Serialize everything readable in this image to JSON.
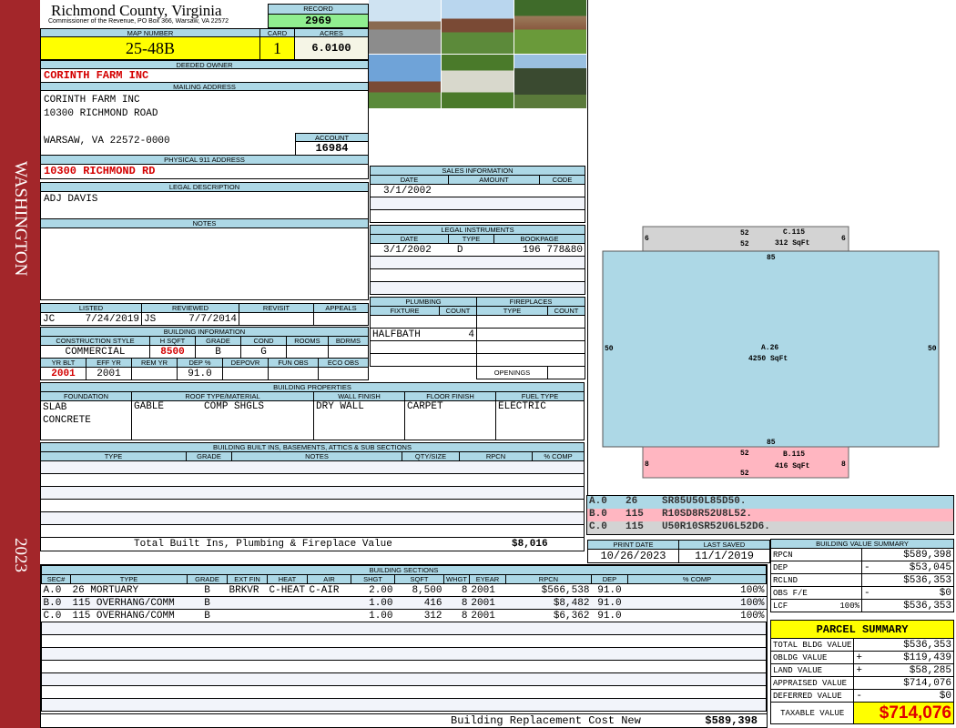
{
  "sidebar": {
    "top_text": "WASHINGTON",
    "bottom_text": "2023",
    "color": "#a3262a"
  },
  "header": {
    "title": "Richmond County, Virginia",
    "subtitle": "Commissioner of the Revenue, PO Box 366, Warsaw, VA 22572",
    "record_label": "RECORD",
    "record": "2969"
  },
  "parcel": {
    "map_label": "MAP NUMBER",
    "map_number": "25-48B",
    "card_label": "CARD",
    "card": "1",
    "acres_label": "ACRES",
    "acres": "6.0100",
    "deeded_owner_label": "DEEDED OWNER",
    "deeded_owner": "CORINTH FARM INC",
    "mailing_label": "MAILING ADDRESS",
    "mailing": [
      "CORINTH FARM INC",
      "10300 RICHMOND ROAD",
      "",
      "WARSAW, VA 22572-0000"
    ],
    "account_label": "ACCOUNT",
    "account": "16984",
    "physical_label": "PHYSICAL 911 ADDRESS",
    "physical": "10300 RICHMOND RD",
    "legal_label": "LEGAL DESCRIPTION",
    "legal": "ADJ DAVIS",
    "notes_label": "NOTES"
  },
  "review": {
    "headers": [
      "LISTED",
      "REVIEWED",
      "REVISIT",
      "APPEALS"
    ],
    "listed_by": "JC",
    "listed_date": "7/24/2019",
    "reviewed_by": "JS",
    "reviewed_date": "7/7/2014"
  },
  "building_info": {
    "title": "BUILDING INFORMATION",
    "headers1": [
      "CONSTRUCTION STYLE",
      "H SQFT",
      "GRADE",
      "COND",
      "ROOMS",
      "BDRMS"
    ],
    "values1": [
      "COMMERCIAL",
      "8500",
      "B",
      "G",
      "",
      ""
    ],
    "headers2": [
      "YR BLT",
      "EFF YR",
      "REM YR",
      "DEP %",
      "DEPOVR",
      "FUN OBS",
      "ECO OBS"
    ],
    "values2": [
      "2001",
      "2001",
      "",
      "91.0",
      "",
      "",
      ""
    ]
  },
  "building_properties": {
    "title": "BUILDING PROPERTIES",
    "headers": [
      "FOUNDATION",
      "ROOF TYPE/MATERIAL",
      "WALL FINISH",
      "FLOOR FINISH",
      "FUEL TYPE"
    ],
    "foundation": [
      "SLAB",
      "CONCRETE"
    ],
    "roof_type": "GABLE",
    "roof_material": "COMP SHGLS",
    "wall": "DRY WALL",
    "floor": "CARPET",
    "fuel": "ELECTRIC"
  },
  "built_ins": {
    "title": "BUILDING BUILT INS, BASEMENTS, ATTICS & SUB SECTIONS",
    "headers": [
      "TYPE",
      "GRADE",
      "NOTES",
      "QTY/SIZE",
      "RPCN",
      "% COMP"
    ],
    "total_label": "Total Built Ins, Plumbing & Fireplace Value",
    "total": "$8,016"
  },
  "sales": {
    "title": "SALES INFORMATION",
    "headers": [
      "DATE",
      "AMOUNT",
      "CODE"
    ],
    "rows": [
      [
        "3/1/2002",
        "",
        ""
      ]
    ]
  },
  "legal_instruments": {
    "title": "LEGAL INSTRUMENTS",
    "headers": [
      "DATE",
      "TYPE",
      "BOOKPAGE"
    ],
    "rows": [
      [
        "3/1/2002",
        "D",
        "196 778&80"
      ]
    ]
  },
  "plumbing": {
    "title": "PLUMBING",
    "headers": [
      "FIXTURE",
      "COUNT"
    ],
    "rows": [
      [
        "",
        ""
      ],
      [
        "HALFBATH",
        "4"
      ]
    ]
  },
  "fireplaces": {
    "title": "FIREPLACES",
    "headers": [
      "TYPE",
      "COUNT"
    ],
    "openings_label": "OPENINGS"
  },
  "sketch": {
    "sections": [
      {
        "label": "A.26",
        "area": "4250 SqFt",
        "dims": [
          "85",
          "85",
          "50",
          "50"
        ],
        "color": "#add8e6"
      },
      {
        "label": "B.115",
        "area": "416 SqFt",
        "dims": [
          "52",
          "52",
          "8",
          "8"
        ],
        "color": "#ffb6c1"
      },
      {
        "label": "C.115",
        "area": "312 SqFt",
        "dims": [
          "52",
          "52",
          "6",
          "6"
        ],
        "color": "#d3d3d3"
      }
    ],
    "vectors": [
      {
        "sec": "A.0",
        "code": "26",
        "path": "SR85U50L85D50.",
        "color": "#add8e6"
      },
      {
        "sec": "B.0",
        "code": "115",
        "path": "R10SD8R52U8L52.",
        "color": "#ffb6c1"
      },
      {
        "sec": "C.0",
        "code": "115",
        "path": "U50R10SR52U6L52D6.",
        "color": "#d3d3d3"
      }
    ]
  },
  "dates": {
    "print_label": "PRINT DATE",
    "print": "10/26/2023",
    "saved_label": "LAST SAVED",
    "saved": "11/1/2019"
  },
  "sections": {
    "title": "BUILDING SECTIONS",
    "headers": [
      "SEC#",
      "TYPE",
      "GRADE",
      "EXT FIN",
      "HEAT",
      "AIR",
      "SHGT",
      "SQFT",
      "WHGT",
      "EYEAR",
      "RPCN",
      "DEP",
      "% COMP"
    ],
    "rows": [
      [
        "A.0",
        "26 MORTUARY",
        "B",
        "BRKVR",
        "C-HEAT",
        "C-AIR",
        "2.00",
        "8,500",
        "8",
        "2001",
        "$566,538",
        "91.0",
        "100%"
      ],
      [
        "B.0",
        "115 OVERHANG/COMM",
        "B",
        "",
        "",
        "",
        "1.00",
        "416",
        "8",
        "2001",
        "$8,482",
        "91.0",
        "100%"
      ],
      [
        "C.0",
        "115 OVERHANG/COMM",
        "B",
        "",
        "",
        "",
        "1.00",
        "312",
        "8",
        "2001",
        "$6,362",
        "91.0",
        "100%"
      ]
    ],
    "total_label": "Building Replacement Cost New",
    "total": "$589,398"
  },
  "value_summary": {
    "title": "BUILDING VALUE SUMMARY",
    "rows": [
      [
        "RPCN",
        "",
        "",
        "$589,398"
      ],
      [
        "DEP",
        "",
        "-",
        "$53,045"
      ],
      [
        "RCLND",
        "",
        "",
        "$536,353"
      ],
      [
        "OBS F/E",
        "",
        "-",
        "$0"
      ],
      [
        "LCF",
        "100%",
        "",
        "$536,353"
      ]
    ]
  },
  "parcel_summary": {
    "title": "PARCEL SUMMARY",
    "rows": [
      [
        "TOTAL BLDG VALUE",
        "",
        "$536,353"
      ],
      [
        "OBLDG VALUE",
        "+",
        "$119,439"
      ],
      [
        "LAND VALUE",
        "+",
        "$58,285"
      ],
      [
        "APPRAISED VALUE",
        "",
        "$714,076"
      ],
      [
        "DEFERRED VALUE",
        "-",
        "$0"
      ]
    ],
    "taxable_label": "TAXABLE VALUE",
    "taxable": "$714,076"
  }
}
